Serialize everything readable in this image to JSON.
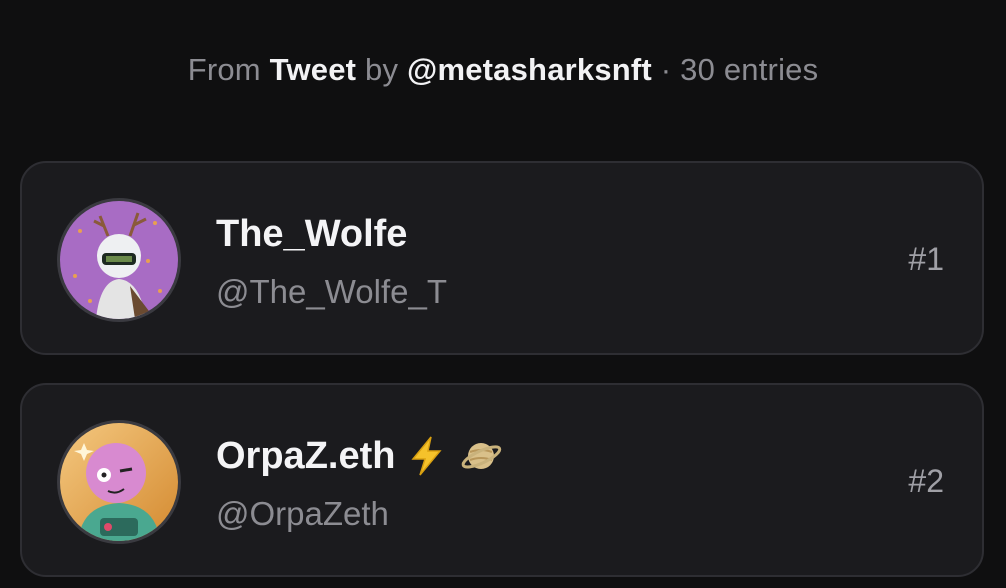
{
  "header": {
    "from_label": "From",
    "source_type": "Tweet",
    "by_label": "by",
    "author_handle": "@metasharksnft",
    "separator": "·",
    "entries_count": "30 entries"
  },
  "entries": [
    {
      "display_name": "The_Wolfe",
      "handle": "@The_Wolfe_T",
      "rank": "#1",
      "avatar_icon": "wolfe-avatar-icon",
      "emojis": []
    },
    {
      "display_name": "OrpaZ.eth",
      "handle": "@OrpaZeth",
      "rank": "#2",
      "avatar_icon": "orpaz-avatar-icon",
      "emojis": [
        "lightning-emoji-icon",
        "ringed-planet-emoji-icon"
      ]
    }
  ],
  "colors": {
    "background": "#0f0f10",
    "card_background": "#1b1b1e",
    "card_border": "#2e2e33",
    "primary_text": "#f4f4f6",
    "secondary_text": "#8c8c92"
  }
}
